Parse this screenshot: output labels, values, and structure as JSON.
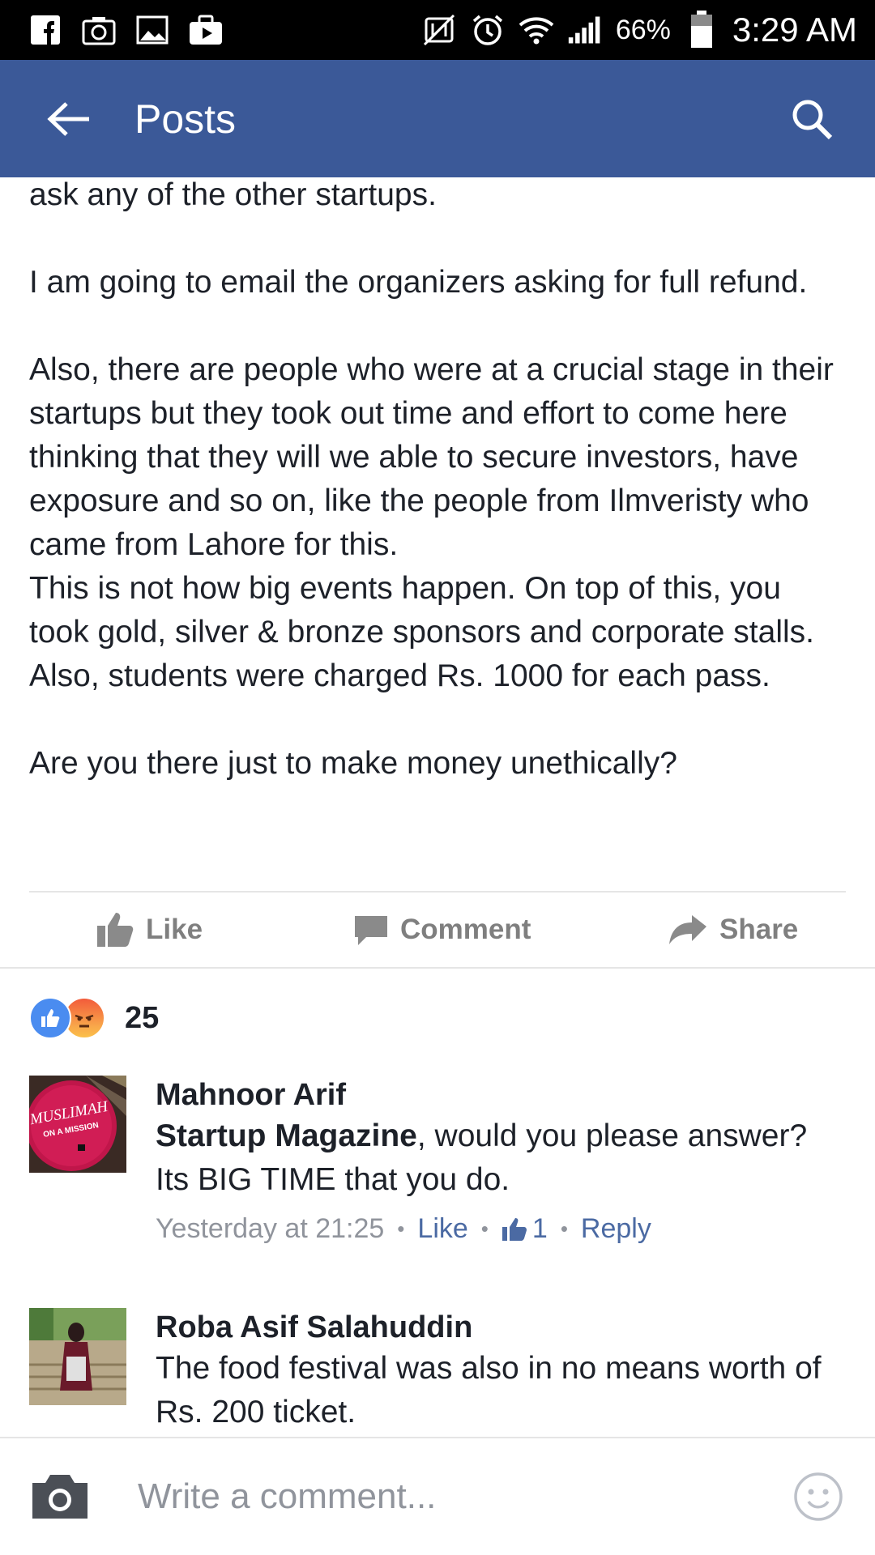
{
  "status_bar": {
    "battery": "66%",
    "time": "3:29 AM",
    "icons_left": [
      "facebook-icon",
      "camera-icon",
      "gallery-icon",
      "briefcase-icon"
    ],
    "icons_right": [
      "nfc-icon",
      "alarm-icon",
      "wifi-icon",
      "signal-icon",
      "battery-icon"
    ]
  },
  "app_bar": {
    "title": "Posts"
  },
  "post": {
    "paragraphs": [
      "ask any of the other startups.",
      "I am going to email the organizers asking for full refund.",
      "Also, there are people who were at a crucial stage in their startups but they took out time and effort to come here thinking that they will we able to secure investors, have exposure and so on, like the people from Ilmveristy who came from Lahore for this.",
      "This is not how big events happen. On top of this, you took gold, silver & bronze sponsors and corporate stalls. Also, students were charged Rs. 1000 for each pass.",
      "Are you there just to make money unethically?"
    ]
  },
  "actions": {
    "like": "Like",
    "comment": "Comment",
    "share": "Share"
  },
  "reactions": {
    "count": "25"
  },
  "comments": [
    {
      "author": "Mahnoor Arif",
      "avatar_text_1": "MUSLIMAH",
      "avatar_text_2": "ON A MISSION",
      "mention": "Startup Magazine",
      "text": ", would you please answer? Its BIG TIME that you do.",
      "time": "Yesterday at 21:25",
      "like_label": "Like",
      "like_count": "1",
      "reply_label": "Reply"
    },
    {
      "author": "Roba Asif Salahuddin",
      "text": "The food festival was also in no means worth of Rs. 200 ticket."
    }
  ],
  "composer": {
    "placeholder": "Write a comment..."
  },
  "colors": {
    "brand_blue": "#3b5998",
    "link_blue": "#4b6aa3",
    "muted_gray": "#90949c"
  }
}
